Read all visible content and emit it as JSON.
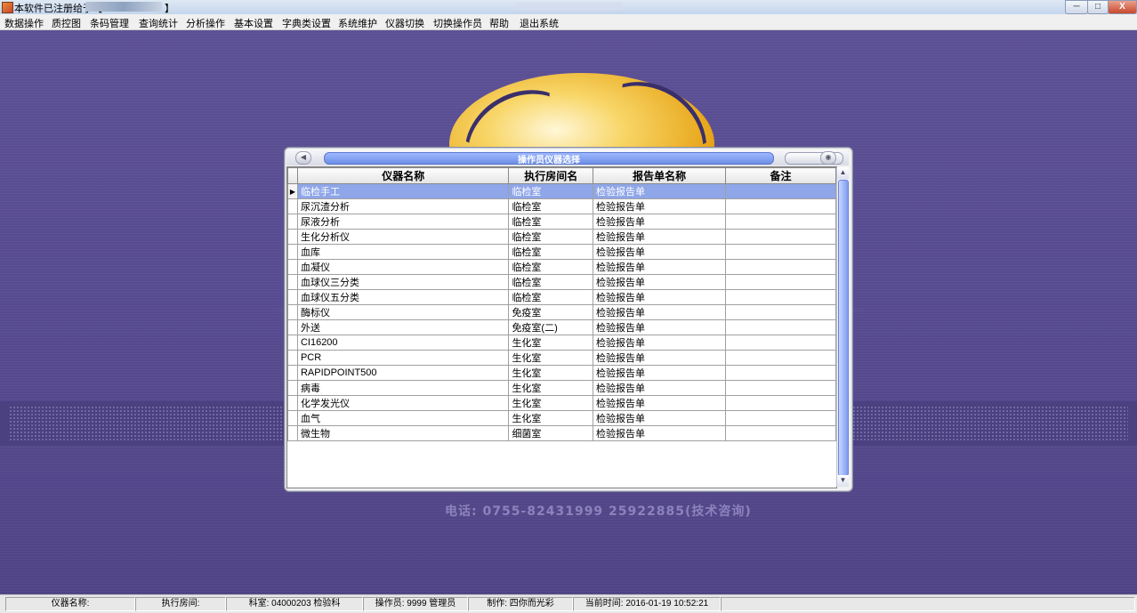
{
  "window": {
    "title": "本软件已注册给于【",
    "title_close": "】",
    "controls": {
      "minimize": "─",
      "maximize": "□",
      "close": "X"
    }
  },
  "menu": [
    "数据操作",
    "质控图",
    "条码管理",
    "查询统计",
    "分析操作",
    "基本设置",
    "字典类设置",
    "系统维护",
    "仪器切换",
    "切换操作员",
    "帮助",
    "退出系统"
  ],
  "background": {
    "phone": "电话: 0755-82431999   25922885(技术咨询)"
  },
  "dialog": {
    "title": "操作员仪器选择",
    "columns": [
      "仪器名称",
      "执行房间名",
      "报告单名称",
      "备注"
    ],
    "selected_row": 0,
    "rows": [
      {
        "name": "临检手工",
        "room": "临检室",
        "report": "检验报告单",
        "note": ""
      },
      {
        "name": "尿沉渣分析",
        "room": "临检室",
        "report": "检验报告单",
        "note": ""
      },
      {
        "name": "尿液分析",
        "room": "临检室",
        "report": "检验报告单",
        "note": ""
      },
      {
        "name": "生化分析仪",
        "room": "临检室",
        "report": "检验报告单",
        "note": ""
      },
      {
        "name": "血库",
        "room": "临检室",
        "report": "检验报告单",
        "note": ""
      },
      {
        "name": "血凝仪",
        "room": "临检室",
        "report": "检验报告单",
        "note": ""
      },
      {
        "name": "血球仪三分类",
        "room": "临检室",
        "report": "检验报告单",
        "note": ""
      },
      {
        "name": "血球仪五分类",
        "room": "临检室",
        "report": "检验报告单",
        "note": ""
      },
      {
        "name": "酶标仪",
        "room": "免疫室",
        "report": "检验报告单",
        "note": ""
      },
      {
        "name": "外送",
        "room": "免疫室(二)",
        "report": "检验报告单",
        "note": ""
      },
      {
        "name": "CI16200",
        "room": "生化室",
        "report": "检验报告单",
        "note": ""
      },
      {
        "name": "PCR",
        "room": "生化室",
        "report": "检验报告单",
        "note": ""
      },
      {
        "name": "RAPIDPOINT500",
        "room": "生化室",
        "report": "检验报告单",
        "note": ""
      },
      {
        "name": "病毒",
        "room": "生化室",
        "report": "检验报告单",
        "note": ""
      },
      {
        "name": "化学发光仪",
        "room": "生化室",
        "report": "检验报告单",
        "note": ""
      },
      {
        "name": "血气",
        "room": "生化室",
        "report": "检验报告单",
        "note": ""
      },
      {
        "name": "微生物",
        "room": "细菌室",
        "report": "检验报告单",
        "note": ""
      }
    ]
  },
  "status": {
    "instrument": "仪器名称:",
    "room": "执行房间:",
    "dept": "科室: 04000203 检验科",
    "operator": "操作员: 9999 管理员",
    "maker": "制作: 四你而光彩",
    "time": "当前时间: 2016-01-19 10:52:21"
  },
  "colors": {
    "desktop": "#5a4d93",
    "selection": "#8fa6e8",
    "dialog_title": "#6d8fe6"
  }
}
